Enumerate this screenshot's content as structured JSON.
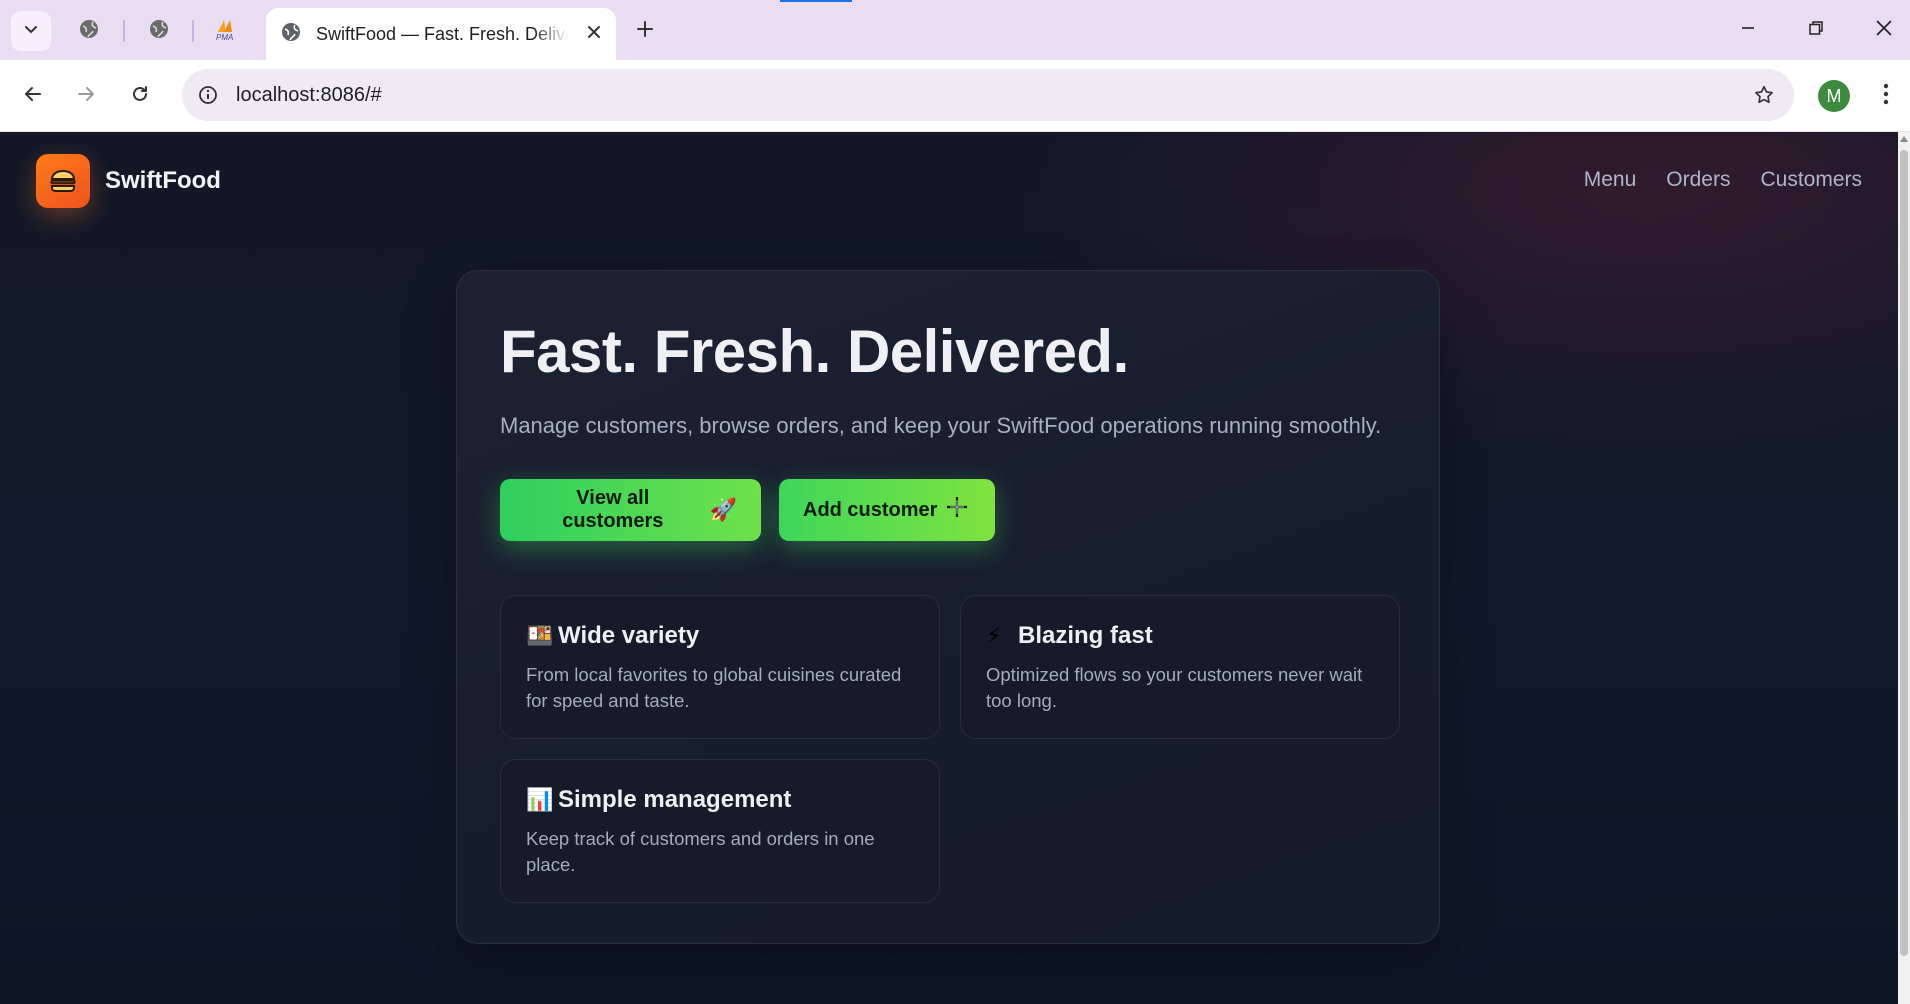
{
  "browser": {
    "active_tab": {
      "title": "SwiftFood — Fast. Fresh. Delivered."
    },
    "pinned_tabs": [
      {
        "icon": "globe-icon"
      },
      {
        "icon": "globe-icon"
      },
      {
        "icon": "phpmyadmin-icon",
        "label": "PMA"
      }
    ],
    "url": "localhost:8086/#",
    "profile_initial": "M"
  },
  "site": {
    "brand": "SwiftFood",
    "logo_icon": "burger-icon",
    "nav": [
      "Menu",
      "Orders",
      "Customers"
    ]
  },
  "hero": {
    "title": "Fast. Fresh. Delivered.",
    "subtitle": "Manage customers, browse orders, and keep your SwiftFood operations running smoothly.",
    "buttons": [
      {
        "label": "View all customers",
        "glyph": "🚀"
      },
      {
        "label": "Add customer",
        "glyph": "+"
      }
    ]
  },
  "features": [
    {
      "emoji": "🍱",
      "title": "Wide variety",
      "description": "From local favorites to global cuisines curated for speed and taste."
    },
    {
      "emoji": "⚡",
      "title": "Blazing fast",
      "description": "Optimized flows so your customers never wait too long."
    },
    {
      "emoji": "📊",
      "title": "Simple management",
      "description": "Keep track of customers and orders in one place."
    }
  ],
  "colors": {
    "accent_green": "#2dcf5e",
    "brand_orange": "#ff7a1a",
    "page_background": "#111a2d"
  }
}
